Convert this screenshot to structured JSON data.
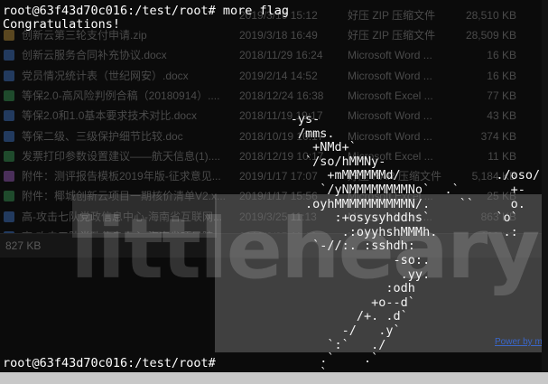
{
  "explorer": {
    "files": [
      {
        "name": "创新云第三轮支付申请.zip",
        "date": "2019/3/18 16:49",
        "type": "好压 ZIP 压缩文件",
        "size": "28,509 KB",
        "kind": "zip"
      },
      {
        "name": "创新云服务合同补充协议.docx",
        "date": "2018/11/29 16:24",
        "type": "Microsoft Word ...",
        "size": "16 KB",
        "kind": "word"
      },
      {
        "name": "党员情况统计表（世纪网安）.docx",
        "date": "2019/2/14 14:52",
        "type": "Microsoft Word ...",
        "size": "16 KB",
        "kind": "word"
      },
      {
        "name": "等保2.0-高风险判例合稿（20180914）....",
        "date": "2018/12/24 16:38",
        "type": "Microsoft Excel ...",
        "size": "77 KB",
        "kind": "excel"
      },
      {
        "name": "等保2.0和1.0基本要求技术对比.docx",
        "date": "2018/11/19 19:17",
        "type": "Microsoft Word ...",
        "size": "43 KB",
        "kind": "word"
      },
      {
        "name": "等保二级、三级保护细节比较.doc",
        "date": "2018/10/19 10:17",
        "type": "Microsoft Word ...",
        "size": "374 KB",
        "kind": "word"
      },
      {
        "name": "发票打印参数设置建议——航天信息(1)....",
        "date": "2018/12/19 10:17",
        "type": "Microsoft Excel ...",
        "size": "11 KB",
        "kind": "excel"
      },
      {
        "name": "附件：测评报告模板2019年版-征求意见...",
        "date": "2019/1/17 17:07",
        "type": "好压 RAR 压缩文件",
        "size": "5,184 KB",
        "kind": "rar"
      },
      {
        "name": "附件：椰城创新云项目一期核价清单V2.x...",
        "date": "2019/1/17 15:56",
        "type": "Microsoft Excel ...",
        "size": "25 KB",
        "kind": "excel"
      },
      {
        "name": "高-攻击七队党政信息中心-海南省互联网...",
        "date": "2019/3/25 11:13",
        "type": "Microsoft Word ...",
        "size": "863 KB",
        "kind": "word"
      },
      {
        "name": "高-攻击五队党政信息中心-海南省项目院...",
        "date": "2019/3/25 11:13",
        "type": "Microsoft Word ...",
        "size": "238 KB",
        "kind": "word"
      }
    ],
    "top_row": {
      "date": "2019/3/19 15:12",
      "type": "好压 ZIP 压缩文件",
      "size": "28,510 KB"
    },
    "status_size": "827 KB"
  },
  "terminal": {
    "command_line": "root@63f43d70c016:/test/root# more flag",
    "output": "Congratulations!",
    "ascii_art": "      -ys-\n       /mms.\n         +NMd+`\n        `/so/hMMNy-\n           +mMMMMMMd/             ./oso/-\n          `/yNMMMMMMMMNo`  .`       +-\n        .oyhMMMMMMMMMMN/.    ``     o.\n            :+osysyhddhs`         `o`\n             .:oyyhshMMMh.         .:\n         `-//:. :sshdh:\n                    -so:.\n                     .yy.\n                   :odh\n                 +o--d`\n               /+. .d`\n             -/   .y`\n           `:`   ./\n          .`    .`\n          `",
    "prompt_line": "root@63f43d70c016:/test/root#"
  },
  "watermark": {
    "text": "littleheary",
    "link": "Power by m"
  }
}
